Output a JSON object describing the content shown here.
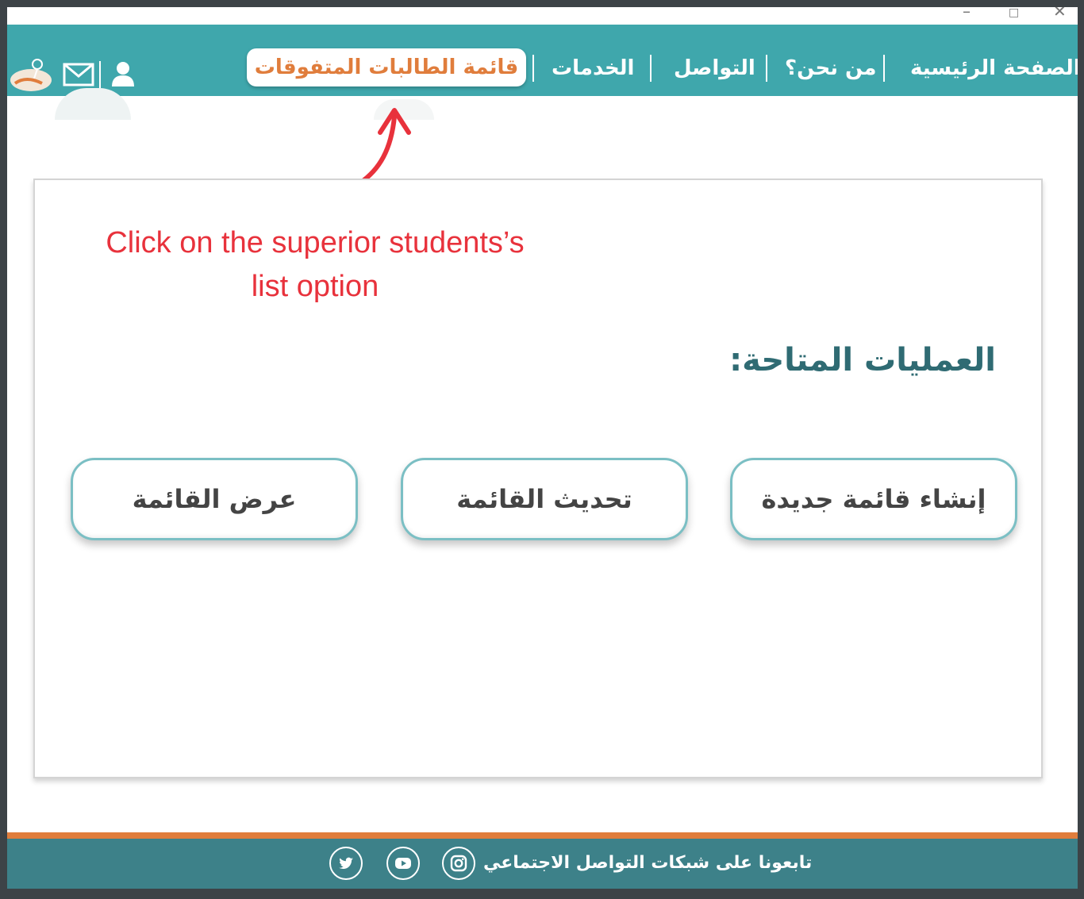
{
  "window": {
    "controls": {
      "minimize": "–",
      "maximize": "□",
      "close": "✕"
    }
  },
  "nav": {
    "items": [
      {
        "id": "home",
        "label": "الصفحة الرئيسية"
      },
      {
        "id": "about",
        "label": "من نحن؟"
      },
      {
        "id": "contact",
        "label": "التواصل"
      },
      {
        "id": "services",
        "label": "الخدمات"
      }
    ],
    "active": {
      "label": "قائمة الطالبات المتفوقات"
    },
    "icons": [
      "user-icon",
      "mail-icon",
      "logo"
    ]
  },
  "annotation": {
    "line1": "Click on the superior students’s",
    "line2": "list option",
    "color": "#e8323c"
  },
  "main": {
    "title": "العمليات المتاحة:",
    "buttons": {
      "new": "إنشاء قائمة جديدة",
      "update": "تحديث القائمة",
      "view": "عرض القائمة"
    }
  },
  "footer": {
    "follow_text": "تابعونا على شبكات التواصل الاجتماعي",
    "social": [
      "instagram-icon",
      "youtube-icon",
      "twitter-icon"
    ]
  },
  "colors": {
    "nav_bg": "#3fa7ac",
    "accent": "#e07d3c",
    "footer_bg": "#3d8189",
    "title": "#2f6b73"
  }
}
